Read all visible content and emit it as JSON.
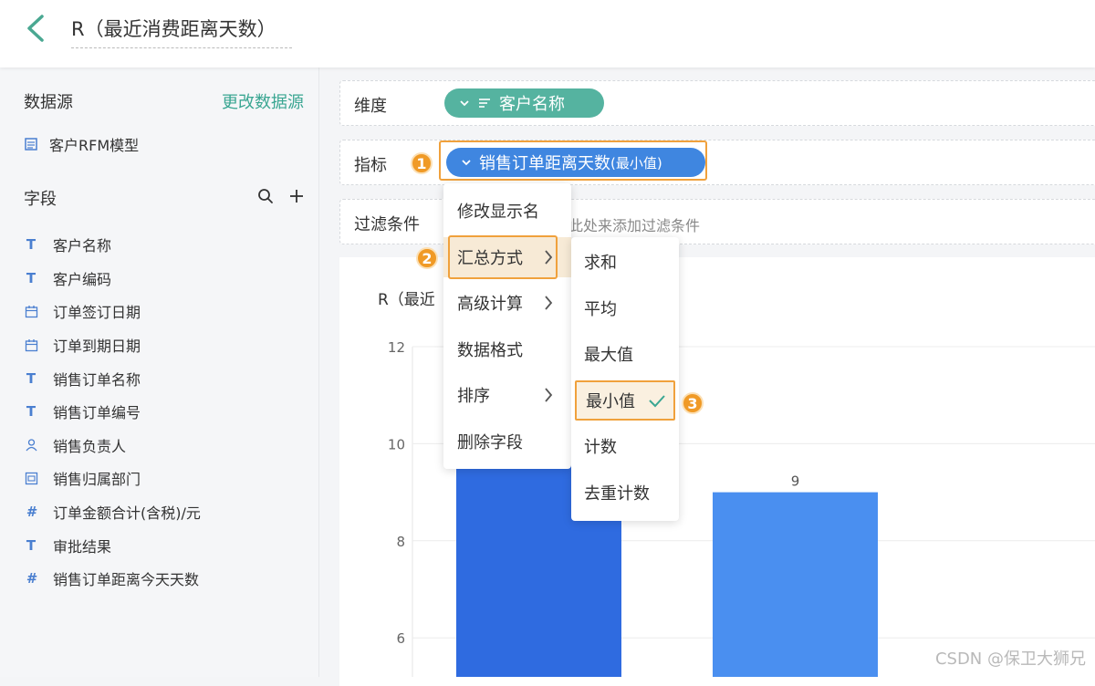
{
  "header": {
    "title": "R（最近消费距离天数）"
  },
  "sidebar": {
    "datasource_title": "数据源",
    "change_datasource": "更改数据源",
    "datasource_name": "客户RFM模型",
    "fields_title": "字段",
    "fields": [
      {
        "label": "客户名称",
        "type": "text"
      },
      {
        "label": "客户编码",
        "type": "text"
      },
      {
        "label": "订单签订日期",
        "type": "date"
      },
      {
        "label": "订单到期日期",
        "type": "date"
      },
      {
        "label": "销售订单名称",
        "type": "text"
      },
      {
        "label": "销售订单编号",
        "type": "text"
      },
      {
        "label": "销售负责人",
        "type": "user"
      },
      {
        "label": "销售归属部门",
        "type": "dept"
      },
      {
        "label": "订单金额合计(含税)/元",
        "type": "number"
      },
      {
        "label": "审批结果",
        "type": "text"
      },
      {
        "label": "销售订单距离今天天数",
        "type": "number"
      }
    ]
  },
  "config": {
    "dimension_label": "维度",
    "dimension_value": "客户名称",
    "metric_label": "指标",
    "metric_value": "销售订单距离天数",
    "metric_agg": "(最小值)",
    "filter_label": "过滤条件",
    "filter_hint": "此处来添加过滤条件",
    "badges": [
      "1",
      "2",
      "3"
    ]
  },
  "menu": {
    "items": [
      "修改显示名",
      "汇总方式",
      "高级计算",
      "数据格式",
      "排序",
      "删除字段"
    ],
    "sub_items": [
      "求和",
      "平均",
      "最大值",
      "最小值",
      "计数",
      "去重计数"
    ]
  },
  "chart": {
    "title_partial": "R（最近",
    "watermark": "CSDN @保卫大狮兄"
  },
  "colors": {
    "accent": "#3aa692",
    "metric": "#3f86e0",
    "highlight": "#f0a13c"
  },
  "chart_data": {
    "type": "bar",
    "categories": [
      "",
      ""
    ],
    "values": [
      12,
      9
    ],
    "data_labels": [
      "",
      "9"
    ],
    "ylim": [
      6,
      12
    ],
    "yticks": [
      12,
      10,
      8,
      6
    ],
    "grid": true
  }
}
